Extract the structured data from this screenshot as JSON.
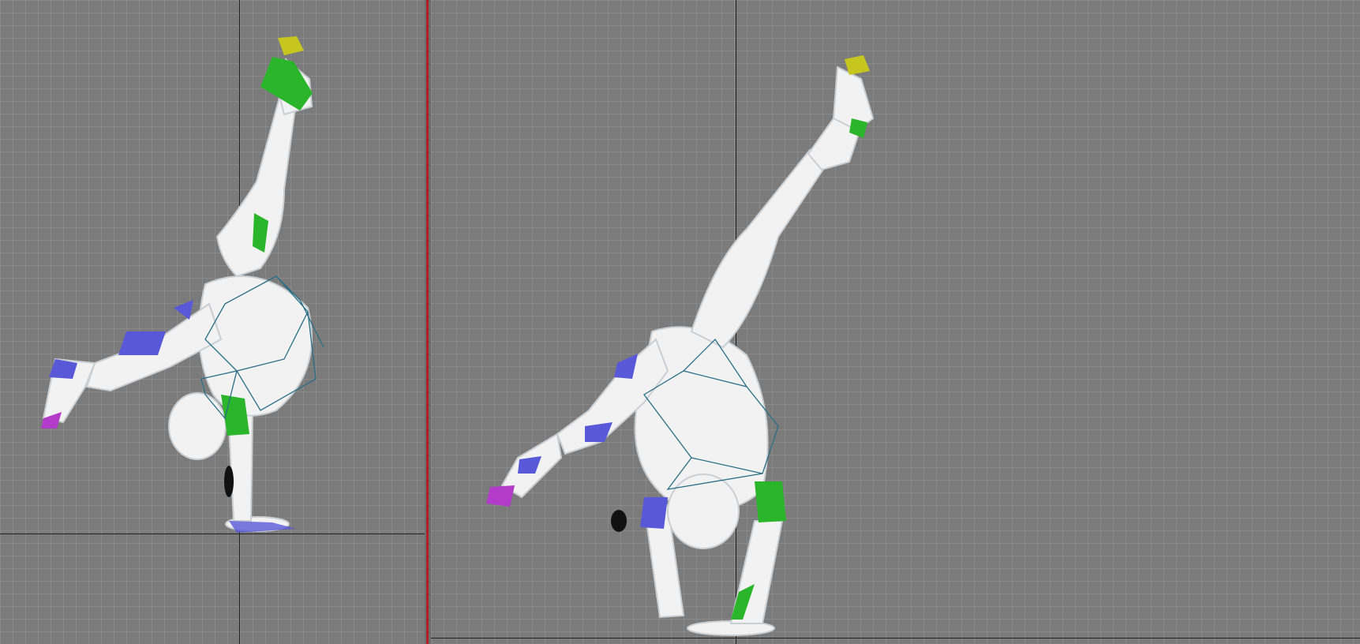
{
  "app": {
    "viewports": [
      {
        "id": "left",
        "view": "side"
      },
      {
        "id": "right",
        "view": "perspective"
      }
    ]
  },
  "mannequin": {
    "body_color": "#f2f2f2",
    "shading_color": "#cfd6da",
    "left_limb_color": "#5858d8",
    "right_limb_color": "#2bb52b",
    "toe_left_color": "#b23bc9",
    "toe_right_color": "#c6c61e",
    "bone_color": "#2a6f86"
  },
  "reference_image": {
    "subject": "anime-fighter-handstand-kick",
    "palette": {
      "magenta": "#ff2a7a",
      "lightning": "#2aa8ff",
      "building": "#d8c9ae",
      "outfit": "#2a2630"
    }
  },
  "colors": {
    "viewport_bg": "#7b7b7b",
    "grid_line": "#969696",
    "axis_line": "#222222",
    "splitter": "#b02020"
  }
}
